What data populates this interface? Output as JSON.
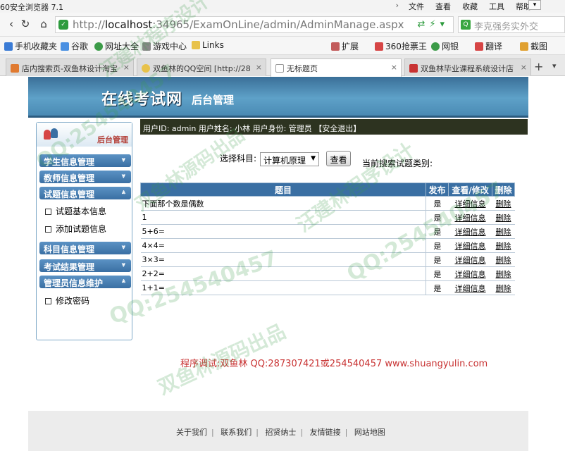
{
  "browser": {
    "window_title": "60安全浏览器 7.1",
    "menu": [
      "文件",
      "查看",
      "收藏",
      "工具",
      "帮助"
    ],
    "url_prefix": "http://",
    "url_host": "localhost",
    "url_rest": ":34965/ExamOnLine/admin/AdminManage.aspx",
    "search_placeholder": "李克强务实外交",
    "bookmarks": [
      "手机收藏夹",
      "谷歌",
      "网址大全",
      "游戏中心",
      "Links",
      "扩展",
      "360抢票王",
      "网银",
      "翻译",
      "截图"
    ],
    "tabs": [
      {
        "label": "店内搜索页-双鱼林设计淘宝"
      },
      {
        "label": "双鱼林的QQ空间 [http://28"
      },
      {
        "label": "无标题页",
        "active": true
      },
      {
        "label": "双鱼林毕业课程系统设计店"
      }
    ]
  },
  "header": {
    "title": "在线考试网",
    "subtitle": "后台管理"
  },
  "sidebar": {
    "top_label": "后台管理",
    "sections": [
      {
        "label": "学生信息管理"
      },
      {
        "label": "教师信息管理"
      },
      {
        "label": "试题信息管理"
      },
      {
        "label": "科目信息管理"
      },
      {
        "label": "考试结果管理"
      },
      {
        "label": "管理员信息维护"
      }
    ],
    "items": [
      {
        "label": "试题基本信息"
      },
      {
        "label": "添加试题信息"
      },
      {
        "label": "修改密码"
      }
    ]
  },
  "infobar": {
    "text": "用户ID: admin  用户姓名: 小林  用户身份: 管理员 【安全退出】"
  },
  "filter": {
    "label": "选择科目:",
    "selected": "计算机原理",
    "button": "查看",
    "current_type_label": "当前搜索试题类别:"
  },
  "table": {
    "headers": [
      "题目",
      "发布",
      "查看/修改",
      "删除"
    ],
    "rows": [
      {
        "question": "下面那个数是偶数",
        "published": "是",
        "view": "详细信息",
        "delete": "删除"
      },
      {
        "question": "1",
        "published": "是",
        "view": "详细信息",
        "delete": "删除"
      },
      {
        "question": "5+6=",
        "published": "是",
        "view": "详细信息",
        "delete": "删除"
      },
      {
        "question": "4×4=",
        "published": "是",
        "view": "详细信息",
        "delete": "删除"
      },
      {
        "question": "3×3=",
        "published": "是",
        "view": "详细信息",
        "delete": "删除"
      },
      {
        "question": "2+2=",
        "published": "是",
        "view": "详细信息",
        "delete": "删除"
      },
      {
        "question": "1+1=",
        "published": "是",
        "view": "详细信息",
        "delete": "删除"
      }
    ]
  },
  "debug_text": "程序调试:双鱼林 QQ:287307421或254540457 www.shuangyulin.com",
  "footer": {
    "links": [
      "关于我们",
      "联系我们",
      "招贤纳士",
      "友情链接",
      "网站地图"
    ]
  },
  "watermarks": [
    "汪建林程序设计",
    "QQ:254540457",
    "双鱼林源码出品",
    "QQ:254540457",
    "汪建林程序设计",
    "QQ:254540457",
    "双鱼林源码出品"
  ],
  "colors": {
    "header": "#4a8ab4",
    "sidebar_heading": "#3a6fa3",
    "infobar": "#2d3320",
    "debug_text": "#c83232",
    "watermark": "#3c9b48"
  }
}
